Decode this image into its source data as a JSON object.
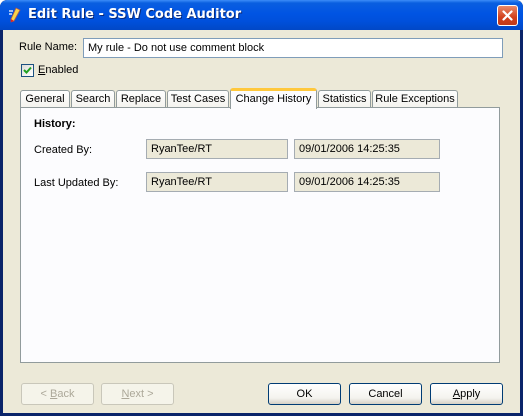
{
  "window": {
    "title": "Edit Rule - SSW Code Auditor",
    "icons": {
      "app": "code-auditor-icon",
      "close": "close-icon"
    }
  },
  "rule": {
    "name_label": "Rule Name:",
    "name_value": "My rule - Do not use comment block",
    "enabled_label": "Enabled",
    "enabled_checked": true
  },
  "tabs": [
    {
      "label": "General",
      "active": false
    },
    {
      "label": "Search",
      "active": false
    },
    {
      "label": "Replace",
      "active": false
    },
    {
      "label": "Test Cases",
      "active": false
    },
    {
      "label": "Change History",
      "active": true
    },
    {
      "label": "Statistics",
      "active": false
    },
    {
      "label": "Rule Exceptions",
      "active": false
    }
  ],
  "history": {
    "heading": "History:",
    "created_label": "Created By:",
    "created_by": "RyanTee/RT",
    "created_date": "09/01/2006 14:25:35",
    "updated_label": "Last Updated By:",
    "updated_by": "RyanTee/RT",
    "updated_date": "09/01/2006 14:25:35"
  },
  "buttons": {
    "back": "< Back",
    "next": "Next >",
    "ok": "OK",
    "cancel": "Cancel",
    "apply": "Apply"
  },
  "colors": {
    "titlebar": "#0054e3",
    "dialog_bg": "#ece9d8",
    "tab_highlight": "#ffc83c",
    "check": "#21a121"
  }
}
